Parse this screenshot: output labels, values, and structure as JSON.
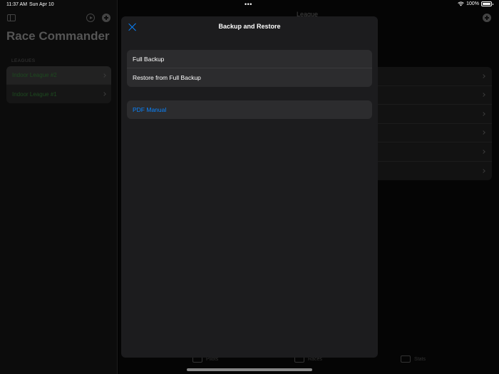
{
  "status_bar": {
    "time": "11:37 AM",
    "date": "Sun Apr 10",
    "battery": "100%"
  },
  "sidebar": {
    "title": "Race Commander",
    "section_header": "LEAGUES",
    "leagues": [
      {
        "label": "Indoor League #2"
      },
      {
        "label": "Indoor League #1"
      }
    ]
  },
  "detail": {
    "title": "League",
    "tabs": [
      {
        "label": "Pilots"
      },
      {
        "label": "Races"
      },
      {
        "label": "Stats"
      }
    ]
  },
  "modal": {
    "title": "Backup and Restore",
    "backup_group": [
      {
        "label": "Full Backup"
      },
      {
        "label": "Restore from Full Backup"
      }
    ],
    "manual_group": [
      {
        "label": "PDF Manual"
      }
    ]
  },
  "colors": {
    "accent": "#0a84ff",
    "sheet_background": "#1c1c1e",
    "row_background": "#2c2c2e",
    "league_text": "#1d4a1f"
  }
}
